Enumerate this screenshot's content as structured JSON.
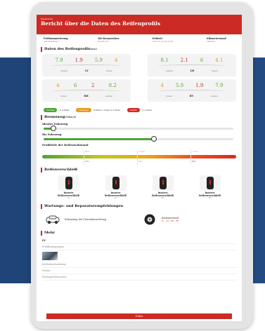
{
  "header": {
    "brand": "BeesiteLite",
    "title": "Bericht über die Daten des Reifenprofils"
  },
  "meta": [
    {
      "key": "Prüfnummerierung",
      "value": "A9T3008002C3"
    },
    {
      "key": "Kfz-Kennzeichen",
      "value": "BG-8612.8"
    },
    {
      "key": "Prüfzeit",
      "value": "2025-01-15 09:41:09"
    },
    {
      "key": "Kilometerstand",
      "value": "5685km"
    }
  ],
  "tread_section": {
    "title": "Daten des Reifenprofils",
    "unit": "(mm)"
  },
  "axles": [
    {
      "values": [
        "7.9",
        "1.9",
        "5.9",
        "4"
      ],
      "colors": [
        "green",
        "red",
        "green",
        "orange"
      ],
      "left": "außen",
      "mid": "LV",
      "right": "innen"
    },
    {
      "values": [
        "8.1",
        "2.1",
        "6",
        "4.1"
      ],
      "colors": [
        "green",
        "red",
        "green",
        "orange"
      ],
      "left": "außen",
      "mid": "LH",
      "right": "innen"
    },
    {
      "values": [
        "4",
        "6",
        "2",
        "8.2"
      ],
      "colors": [
        "orange",
        "green",
        "red",
        "green"
      ],
      "left": "innen",
      "mid": "RH",
      "right": "außen"
    },
    {
      "values": [
        "4",
        "5.9",
        "1.9",
        "7.9"
      ],
      "colors": [
        "orange",
        "green",
        "red",
        "green"
      ],
      "left": "innen",
      "mid": "RV",
      "right": "außen"
    }
  ],
  "legend": [
    {
      "pill": "Normal",
      "text": "≥ 4.0mm",
      "color": "#4fa335"
    },
    {
      "pill": "Warnung",
      "text": "4.0mm > Tiefe ≥ 3.2mm",
      "color": "#e59a1a"
    },
    {
      "pill": "Gefahr",
      "text": "< 3.2mm",
      "color": "#d8281e"
    }
  ],
  "brake": {
    "title": "Bremsweg",
    "unit": "(80km/h)",
    "ideal_label": "Ideales Fahrzeug",
    "ideal_level": 0.05,
    "your_label": "Ihr Fahrzeug",
    "your_level": 0.58,
    "scale_label": "Profiltiefe der Reifen&Abstand",
    "top_ticks": [
      "8mm",
      "3.2mm",
      "1.6mm"
    ],
    "bottom_ticks": [
      "38m",
      "54m",
      "60m"
    ]
  },
  "wear": {
    "title": "Reifenverschleiß",
    "tires": [
      {
        "name": "Innerer Reifenverschleiß",
        "pos": "LV"
      },
      {
        "name": "Innerer Reifenverschleiß",
        "pos": "LH"
      },
      {
        "name": "Innerer Reifenverschleiß",
        "pos": "RH"
      },
      {
        "name": "Innerer Reifenverschleiß",
        "pos": "RV"
      }
    ]
  },
  "maintenance": {
    "title": "Wartungs- und Reparaturempfehlungen",
    "items": [
      {
        "text": "Erkennung der Vierradausrichtung",
        "sub": ""
      },
      {
        "text": "Reifenwechsel",
        "sub": "LV · LH · RH · RV"
      }
    ]
  },
  "more": {
    "title": "Mehr",
    "rows": [
      "LV",
      "Profilbedingungen",
      "Reifenbeschreibung",
      "Nester",
      "Reifengeschlossenes"
    ]
  },
  "footer_button": "Teilen"
}
